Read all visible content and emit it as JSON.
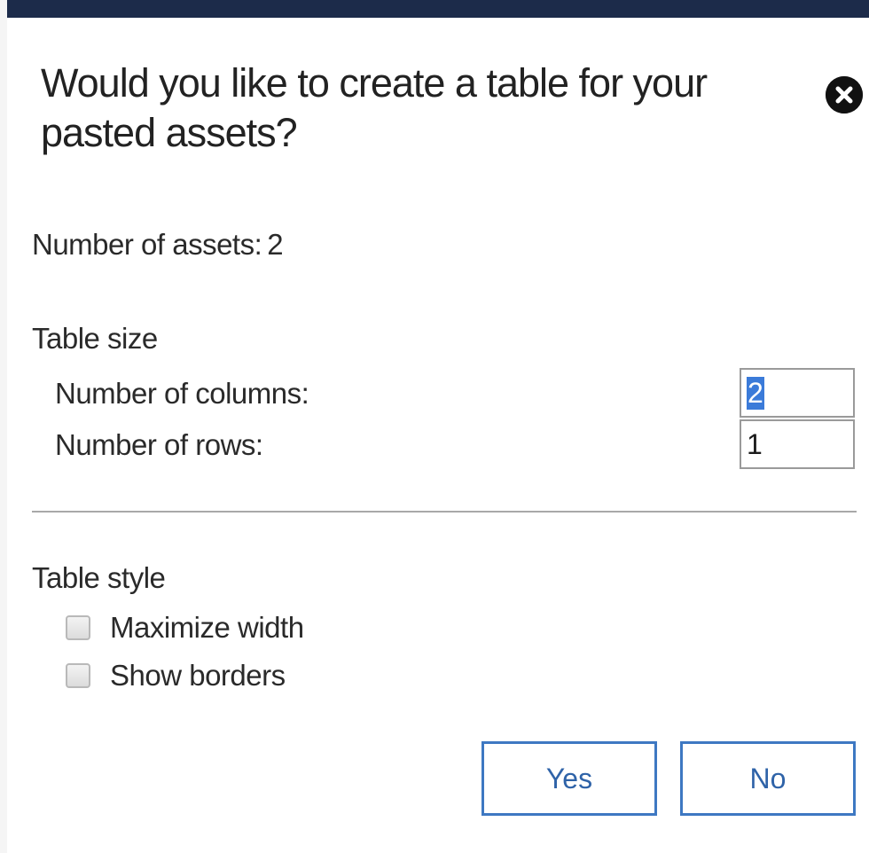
{
  "dialog": {
    "title": "Would you like to create a table for your pasted assets?",
    "close_icon": "close-circle-icon",
    "accent_color": "#1c2b4a",
    "button_color": "#3e78c2"
  },
  "assets": {
    "label": "Number of assets:",
    "value": "2"
  },
  "table_size": {
    "heading": "Table size",
    "columns_label": "Number of columns:",
    "columns_value": "2",
    "rows_label": "Number of rows:",
    "rows_value": "1"
  },
  "table_style": {
    "heading": "Table style",
    "options": [
      {
        "label": "Maximize width",
        "checked": false
      },
      {
        "label": "Show borders",
        "checked": false
      }
    ]
  },
  "actions": {
    "yes_label": "Yes",
    "no_label": "No"
  }
}
